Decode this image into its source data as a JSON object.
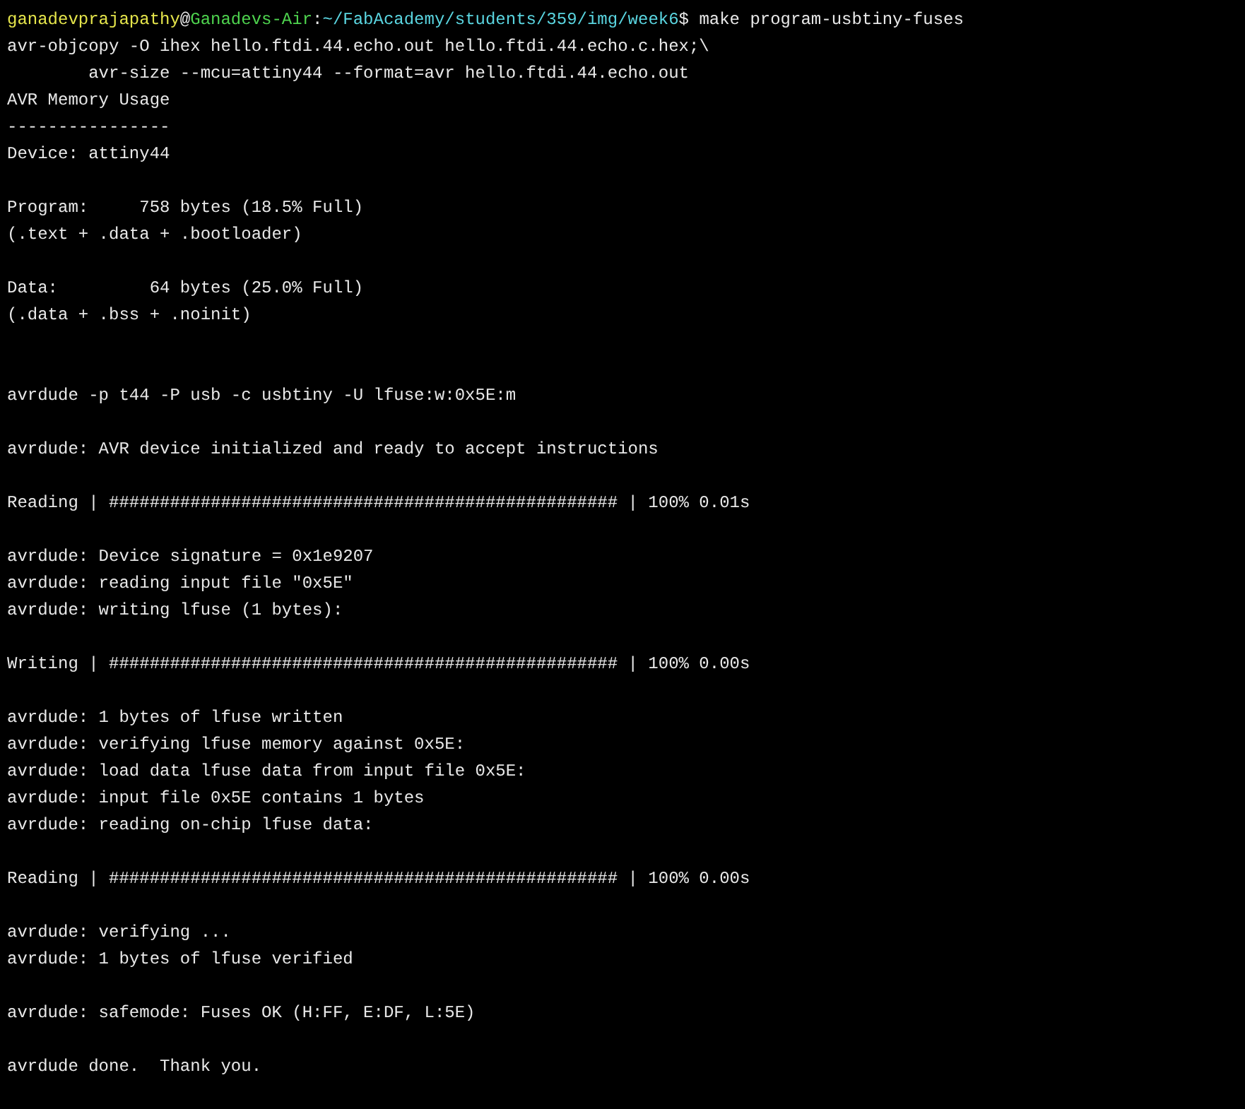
{
  "terminal": {
    "prompt": {
      "user": "ganadevprajapathy",
      "at": "@",
      "host": "Ganadevs-Air",
      "sep": ":",
      "path": "~/FabAcademy/students/359/img/week6",
      "symbol": "$",
      "command": " make program-usbtiny-fuses"
    },
    "lines": [
      {
        "kind": "text",
        "text": "avr-objcopy -O ihex hello.ftdi.44.echo.out hello.ftdi.44.echo.c.hex;\\"
      },
      {
        "kind": "text",
        "text": "        avr-size --mcu=attiny44 --format=avr hello.ftdi.44.echo.out"
      },
      {
        "kind": "text",
        "text": "AVR Memory Usage"
      },
      {
        "kind": "text",
        "text": "----------------"
      },
      {
        "kind": "text",
        "text": "Device: attiny44"
      },
      {
        "kind": "blank"
      },
      {
        "kind": "text",
        "text": "Program:     758 bytes (18.5% Full)"
      },
      {
        "kind": "text",
        "text": "(.text + .data + .bootloader)"
      },
      {
        "kind": "blank"
      },
      {
        "kind": "text",
        "text": "Data:         64 bytes (25.0% Full)"
      },
      {
        "kind": "text",
        "text": "(.data + .bss + .noinit)"
      },
      {
        "kind": "blank"
      },
      {
        "kind": "blank"
      },
      {
        "kind": "text",
        "text": "avrdude -p t44 -P usb -c usbtiny -U lfuse:w:0x5E:m"
      },
      {
        "kind": "blank"
      },
      {
        "kind": "text",
        "text": "avrdude: AVR device initialized and ready to accept instructions"
      },
      {
        "kind": "blank"
      },
      {
        "kind": "text",
        "text": "Reading | ################################################## | 100% 0.01s"
      },
      {
        "kind": "blank"
      },
      {
        "kind": "text",
        "text": "avrdude: Device signature = 0x1e9207"
      },
      {
        "kind": "text",
        "text": "avrdude: reading input file \"0x5E\""
      },
      {
        "kind": "text",
        "text": "avrdude: writing lfuse (1 bytes):"
      },
      {
        "kind": "blank"
      },
      {
        "kind": "text",
        "text": "Writing | ################################################## | 100% 0.00s"
      },
      {
        "kind": "blank"
      },
      {
        "kind": "text",
        "text": "avrdude: 1 bytes of lfuse written"
      },
      {
        "kind": "text",
        "text": "avrdude: verifying lfuse memory against 0x5E:"
      },
      {
        "kind": "text",
        "text": "avrdude: load data lfuse data from input file 0x5E:"
      },
      {
        "kind": "text",
        "text": "avrdude: input file 0x5E contains 1 bytes"
      },
      {
        "kind": "text",
        "text": "avrdude: reading on-chip lfuse data:"
      },
      {
        "kind": "blank"
      },
      {
        "kind": "text",
        "text": "Reading | ################################################## | 100% 0.00s"
      },
      {
        "kind": "blank"
      },
      {
        "kind": "text",
        "text": "avrdude: verifying ..."
      },
      {
        "kind": "text",
        "text": "avrdude: 1 bytes of lfuse verified"
      },
      {
        "kind": "blank"
      },
      {
        "kind": "text",
        "text": "avrdude: safemode: Fuses OK (H:FF, E:DF, L:5E)"
      },
      {
        "kind": "blank"
      },
      {
        "kind": "text",
        "text": "avrdude done.  Thank you."
      }
    ]
  }
}
